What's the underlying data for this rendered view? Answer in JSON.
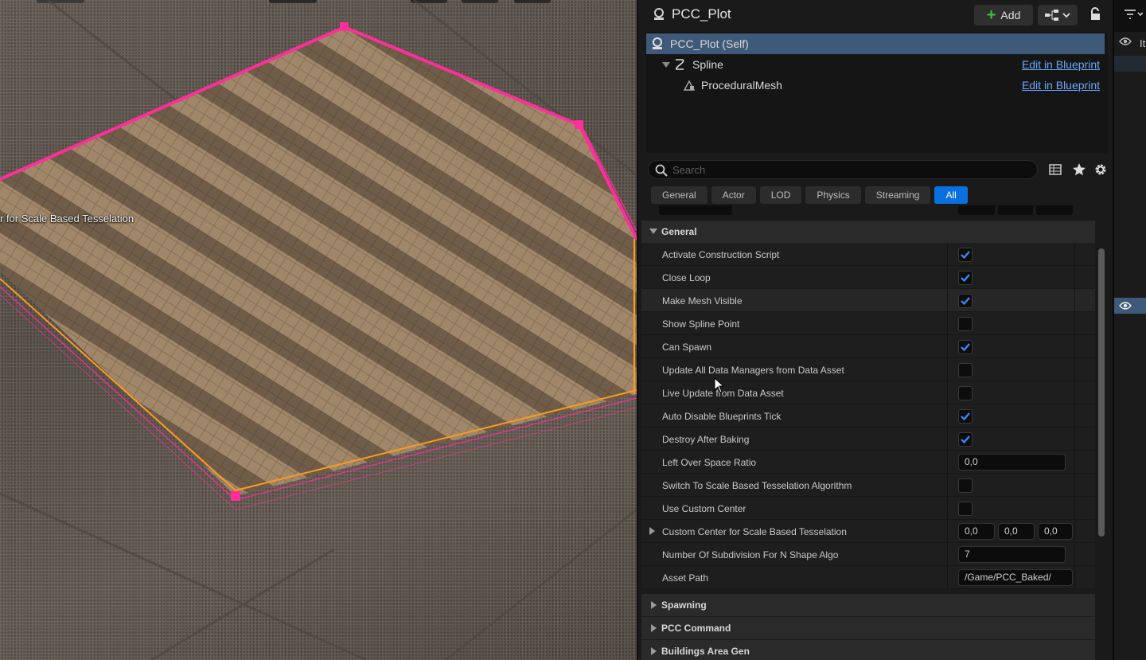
{
  "viewport": {
    "overlay_label": "r for Scale Based Tesselation",
    "colors": {
      "spline": "#ff2e9a",
      "selection": "#ff9a1f",
      "surface": "#9a8066"
    }
  },
  "details": {
    "title": "PCC_Plot",
    "add_label": "Add",
    "components": [
      {
        "label": "PCC_Plot (Self)",
        "icon": "actor-icon",
        "link": ""
      },
      {
        "label": "Spline",
        "icon": "spline-icon",
        "link": "Edit in Blueprint"
      },
      {
        "label": "ProceduralMesh",
        "icon": "mesh-icon",
        "link": "Edit in Blueprint"
      }
    ],
    "search": {
      "placeholder": "Search"
    },
    "filter_tabs": [
      "General",
      "Actor",
      "LOD",
      "Physics",
      "Streaming",
      "All"
    ],
    "active_tab": "All",
    "section_general": "General",
    "properties": [
      {
        "name": "Activate Construction Script",
        "type": "bool",
        "checked": true
      },
      {
        "name": "Close Loop",
        "type": "bool",
        "checked": true
      },
      {
        "name": "Make Mesh Visible",
        "type": "bool",
        "checked": true
      },
      {
        "name": "Show Spline Point",
        "type": "bool",
        "checked": false
      },
      {
        "name": "Can Spawn",
        "type": "bool",
        "checked": true
      },
      {
        "name": "Update All Data Managers from Data Asset",
        "type": "bool",
        "checked": false
      },
      {
        "name": "Live Update from Data Asset",
        "type": "bool",
        "checked": false
      },
      {
        "name": "Auto Disable Blueprints Tick",
        "type": "bool",
        "checked": true
      },
      {
        "name": "Destroy After Baking",
        "type": "bool",
        "checked": true
      },
      {
        "name": "Left Over Space Ratio",
        "type": "float",
        "value": "0,0"
      },
      {
        "name": "Switch To Scale Based Tesselation Algorithm",
        "type": "bool",
        "checked": false
      },
      {
        "name": "Use Custom Center",
        "type": "bool",
        "checked": false
      },
      {
        "name": "Custom Center for Scale Based Tesselation",
        "type": "vector",
        "values": [
          "0,0",
          "0,0",
          "0,0"
        ]
      },
      {
        "name": "Number Of Subdivision For N Shape Algo",
        "type": "int",
        "value": "7"
      },
      {
        "name": "Asset Path",
        "type": "text",
        "value": "/Game/PCC_Baked/"
      }
    ],
    "collapsed_sections": [
      "Spawning",
      "PCC Command",
      "Buildings Area Gen"
    ],
    "accent": "#0a70e0"
  },
  "outliner_strip": {
    "label": "It"
  }
}
